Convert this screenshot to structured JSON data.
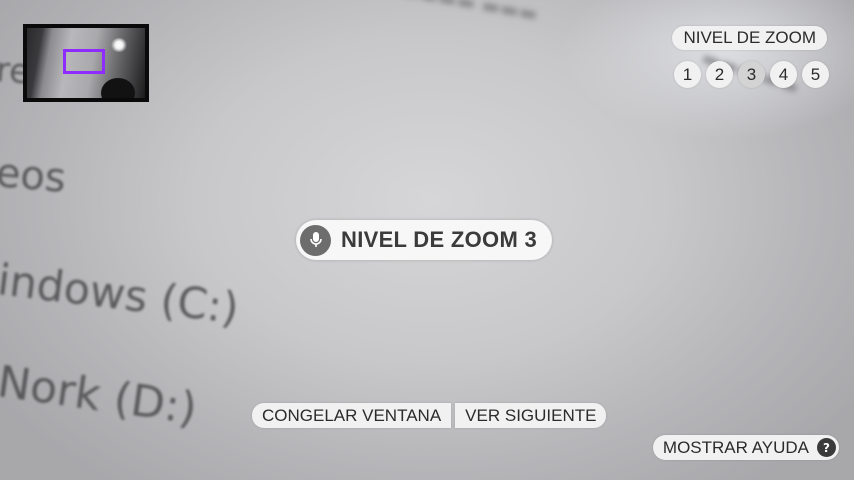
{
  "camera_view": {
    "visible_text": [
      {
        "id": "line1",
        "text": "re"
      },
      {
        "id": "line2",
        "text": "eos"
      },
      {
        "id": "line3",
        "text": "indows  (C:)"
      },
      {
        "id": "line4",
        "text": "Nork (D:)"
      }
    ]
  },
  "minimap": {
    "frame_color": "#8e2bff"
  },
  "zoom_panel": {
    "title": "NIVEL DE ZOOM",
    "levels": [
      "1",
      "2",
      "3",
      "4",
      "5"
    ],
    "active_level": "3"
  },
  "voice_indicator": {
    "icon": "microphone-icon",
    "text": "NIVEL DE ZOOM 3"
  },
  "actions": {
    "freeze_label": "CONGELAR VENTANA",
    "next_label": "VER SIGUIENTE"
  },
  "help": {
    "label": "MOSTRAR AYUDA",
    "icon_glyph": "?"
  },
  "colors": {
    "pill_background": "#f1f1f1",
    "text": "#2b2b2b",
    "accent": "#8e2bff"
  }
}
